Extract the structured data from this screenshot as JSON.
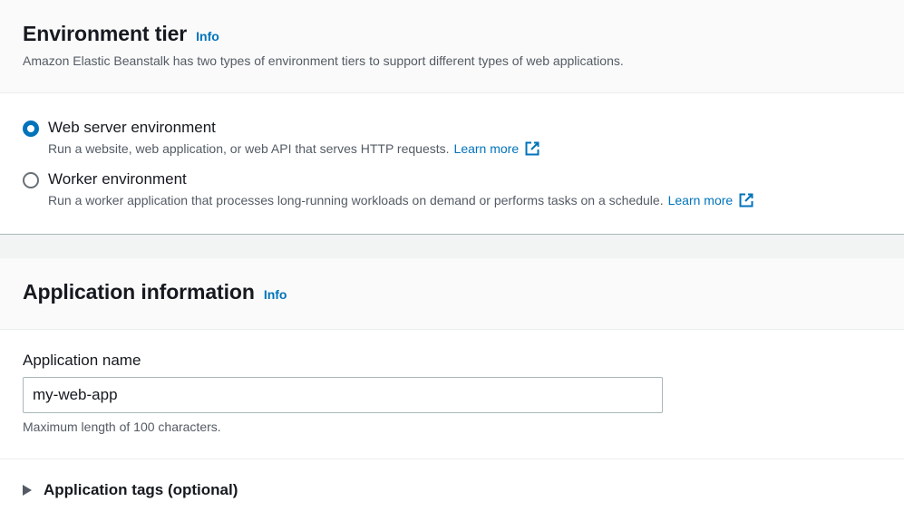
{
  "env_tier": {
    "title": "Environment tier",
    "info": "Info",
    "description": "Amazon Elastic Beanstalk has two types of environment tiers to support different types of web applications.",
    "options": [
      {
        "label": "Web server environment",
        "description": "Run a website, web application, or web API that serves HTTP requests.",
        "link": "Learn more",
        "selected": true
      },
      {
        "label": "Worker environment",
        "description": "Run a worker application that processes long-running workloads on demand or performs tasks on a schedule.",
        "link": "Learn more",
        "selected": false
      }
    ]
  },
  "app_info": {
    "title": "Application information",
    "info": "Info",
    "name_label": "Application name",
    "name_value": "my-web-app",
    "constraint": "Maximum length of 100 characters.",
    "tags_label": "Application tags (optional)"
  },
  "colors": {
    "accent": "#0073bb",
    "text": "#16191f",
    "muted": "#545b64"
  }
}
